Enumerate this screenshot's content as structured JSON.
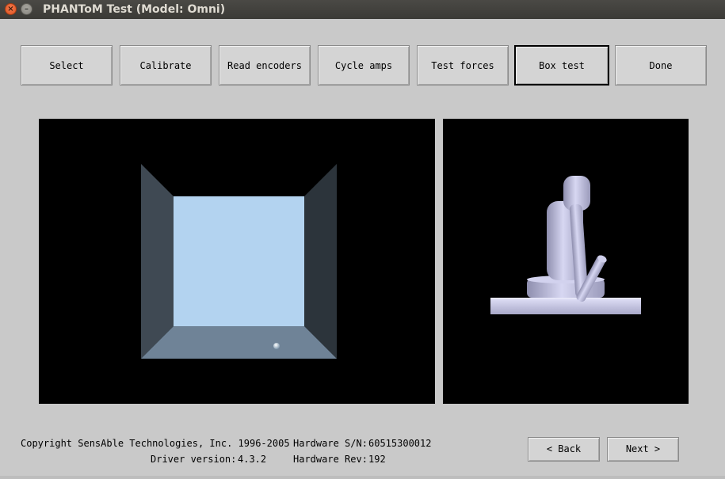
{
  "window": {
    "title": "PHANToM Test (Model: Omni)",
    "close_glyph": "×",
    "minimize_glyph": "–"
  },
  "toolbar": {
    "buttons": [
      {
        "label": "Select",
        "active": false
      },
      {
        "label": "Calibrate",
        "active": false
      },
      {
        "label": "Read encoders",
        "active": false
      },
      {
        "label": "Cycle amps",
        "active": false
      },
      {
        "label": "Test forces",
        "active": false
      },
      {
        "label": "Box test",
        "active": true
      },
      {
        "label": "Done",
        "active": false
      }
    ]
  },
  "scene": {
    "box_back_wall_color": "#b3d3f0",
    "box_floor_color": "#6f8397",
    "box_left_wall_color": "#3f4953",
    "box_right_wall_color": "#2c343b",
    "cursor_color": "#e8f2fa",
    "model_color": "#c9c9e8",
    "background_color": "#000000"
  },
  "footer": {
    "copyright": "Copyright SensAble Technologies, Inc. 1996-2005",
    "driver_label": "Driver version:",
    "driver_value": "4.3.2",
    "serial_label": "Hardware S/N:",
    "serial_value": "60515300012",
    "rev_label": "Hardware Rev:",
    "rev_value": "192"
  },
  "nav": {
    "back_label": "< Back",
    "next_label": "Next >"
  }
}
